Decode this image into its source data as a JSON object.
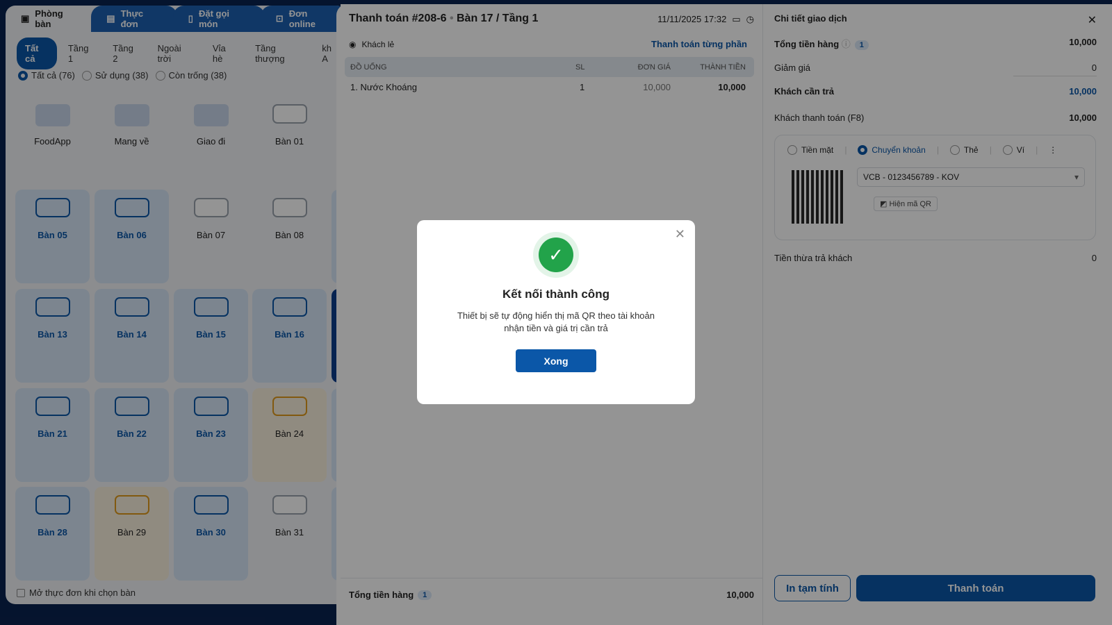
{
  "nav_tabs": [
    {
      "label": "Phòng bàn",
      "icon": "table-icon",
      "active": true
    },
    {
      "label": "Thực đơn",
      "icon": "menu-icon"
    },
    {
      "label": "Đặt gọi món",
      "icon": "phone-order-icon"
    },
    {
      "label": "Đơn online",
      "icon": "bag-icon"
    }
  ],
  "floors": [
    {
      "label": "Tất cả",
      "active": true
    },
    {
      "label": "Tầng 1"
    },
    {
      "label": "Tầng 2"
    },
    {
      "label": "Ngoài trời"
    },
    {
      "label": "Vỉa hè"
    },
    {
      "label": "Tầng thượng"
    },
    {
      "label": "kh A"
    }
  ],
  "filters": [
    {
      "label": "Tất cả (76)",
      "checked": true
    },
    {
      "label": "Sử dụng (38)"
    },
    {
      "label": "Còn trống (38)"
    }
  ],
  "special": [
    {
      "label": "FoodApp",
      "icon": "foodapp-icon"
    },
    {
      "label": "Mang về",
      "icon": "takeaway-bag-icon"
    },
    {
      "label": "Giao đi",
      "icon": "scooter-icon"
    },
    {
      "label": "Bàn 01",
      "icon": "table-icon"
    }
  ],
  "tables": [
    [
      {
        "label": "Bàn 05",
        "status": "blue"
      },
      {
        "label": "Bàn 06",
        "status": "blue"
      },
      {
        "label": "Bàn 07",
        "status": "empty"
      },
      {
        "label": "Bàn 08",
        "status": "empty"
      },
      {
        "label": "",
        "status": "blue"
      }
    ],
    [
      {
        "label": "Bàn 13",
        "status": "blue"
      },
      {
        "label": "Bàn 14",
        "status": "blue"
      },
      {
        "label": "Bàn 15",
        "status": "blue"
      },
      {
        "label": "Bàn 16",
        "status": "blue"
      },
      {
        "label": "",
        "status": "sel"
      }
    ],
    [
      {
        "label": "Bàn 21",
        "status": "blue"
      },
      {
        "label": "Bàn 22",
        "status": "blue"
      },
      {
        "label": "Bàn 23",
        "status": "blue"
      },
      {
        "label": "Bàn 24",
        "status": "orange"
      },
      {
        "label": "",
        "status": "blue"
      }
    ],
    [
      {
        "label": "Bàn 28",
        "status": "blue"
      },
      {
        "label": "Bàn 29",
        "status": "orange"
      },
      {
        "label": "Bàn 30",
        "status": "blue"
      },
      {
        "label": "Bàn 31",
        "status": "empty"
      },
      {
        "label": "",
        "status": "blue"
      }
    ]
  ],
  "open_menu_label": "Mở thực đơn khi chọn bàn",
  "payment": {
    "title": "Thanh toán #208-6",
    "table": "Bàn 17 / Tầng 1",
    "datetime": "11/11/2025 17:32",
    "customer": "Khách lẻ",
    "partial": "Thanh toán từng phần",
    "columns": [
      "ĐỒ UỐNG",
      "SL",
      "ĐƠN GIÁ",
      "THÀNH TIỀN"
    ],
    "items": [
      {
        "name": "1. Nước Khoáng",
        "qty": "1",
        "price": "10,000",
        "total": "10,000"
      }
    ],
    "footer_label": "Tổng tiền hàng",
    "footer_count": "1",
    "footer_total": "10,000"
  },
  "details": {
    "title": "Chi tiết giao dịch",
    "total_label": "Tổng tiền hàng",
    "total_count": "1",
    "total": "10,000",
    "discount_label": "Giảm giá",
    "discount": "0",
    "due_label": "Khách cần trả",
    "due": "10,000",
    "paid_label": "Khách thanh toán (F8)",
    "paid": "10,000",
    "methods": [
      {
        "label": "Tiền mặt"
      },
      {
        "label": "Chuyển khoản",
        "checked": true
      },
      {
        "label": "Thẻ"
      },
      {
        "label": "Ví"
      }
    ],
    "account": "VCB - 0123456789 - KOV",
    "show_qr": "Hiện mã QR",
    "change_label": "Tiền thừa trả khách",
    "change": "0",
    "print_label": "In tạm tính",
    "pay_label": "Thanh toán"
  },
  "modal": {
    "title": "Kết nối thành công",
    "body": "Thiết bị sẽ tự động hiển thị mã QR theo tài khoản nhận tiền và giá trị cần trả",
    "button": "Xong"
  },
  "colors": {
    "primary": "#0b57a8",
    "success": "#22a34a",
    "reserved": "#e09a1b"
  }
}
